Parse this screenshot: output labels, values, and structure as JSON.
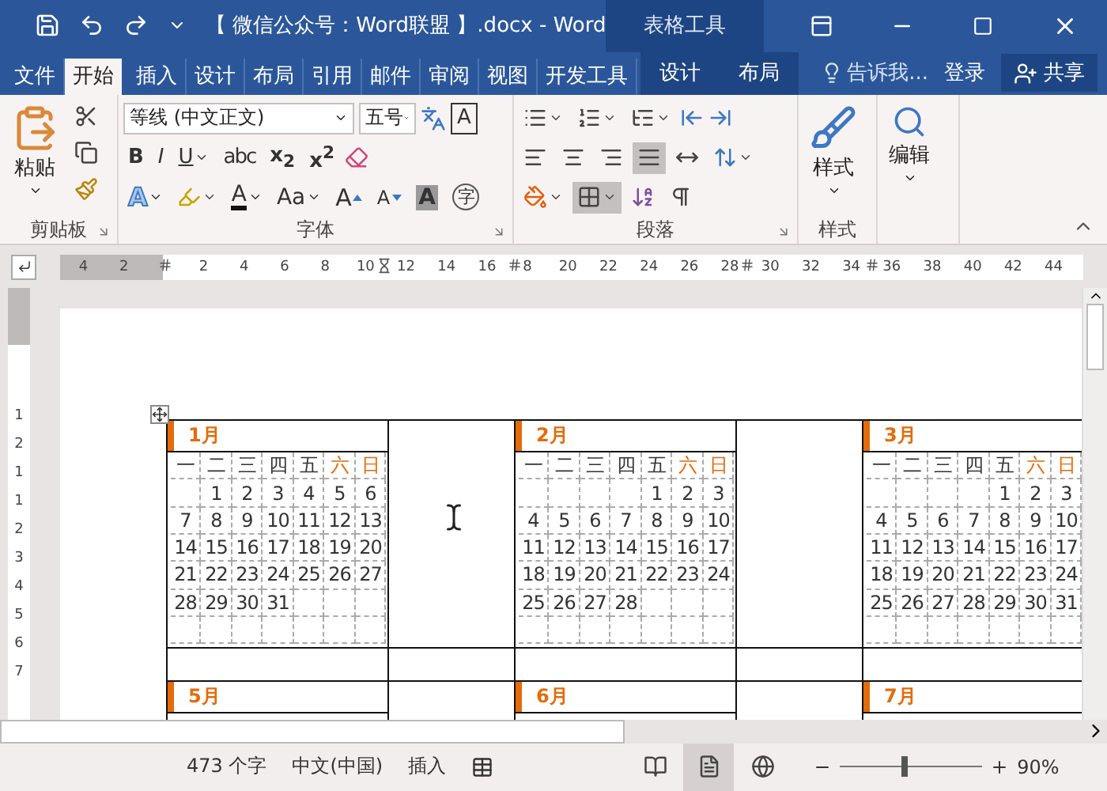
{
  "window": {
    "title": "【 微信公众号：Word联盟 】.docx - Word",
    "context_group": "表格工具"
  },
  "tabs": [
    {
      "label": "文件",
      "selected": false
    },
    {
      "label": "开始",
      "selected": true
    },
    {
      "label": "插入",
      "selected": false
    },
    {
      "label": "设计",
      "selected": false
    },
    {
      "label": "布局",
      "selected": false
    },
    {
      "label": "引用",
      "selected": false
    },
    {
      "label": "邮件",
      "selected": false
    },
    {
      "label": "审阅",
      "selected": false
    },
    {
      "label": "视图",
      "selected": false
    },
    {
      "label": "开发工具",
      "selected": false
    }
  ],
  "context_tabs": [
    {
      "label": "设计",
      "selected": false
    },
    {
      "label": "布局",
      "selected": false
    }
  ],
  "tell_me": "告诉我...",
  "sign_in": "登录",
  "share": "共享",
  "clipboard": {
    "label": "剪贴板",
    "paste": "粘贴"
  },
  "font": {
    "label": "字体",
    "font_name": "等线 (中文正文)",
    "font_size": "五号",
    "border_button": "A",
    "format_buttons": [
      {
        "label": "B",
        "kind": "bold"
      },
      {
        "label": "I",
        "kind": "italic"
      },
      {
        "label": "U",
        "kind": "underline"
      },
      {
        "label": "abc",
        "kind": "strike"
      },
      {
        "label": "x$_{2}$",
        "kind": "sub"
      },
      {
        "label": "x$^{2}$",
        "kind": "sup"
      }
    ],
    "effect_buttons": [
      {
        "label": "A",
        "kind": "effects"
      },
      {
        "kind": "highlight"
      },
      {
        "label": "A",
        "kind": "color"
      },
      {
        "label": "Aa",
        "kind": "case"
      },
      {
        "label": "A",
        "kind": "grow"
      },
      {
        "label": "A",
        "kind": "shrink"
      },
      {
        "label": "A",
        "kind": "shading"
      },
      {
        "label": "字",
        "kind": "enclose"
      }
    ]
  },
  "paragraph": {
    "label": "段落",
    "borders": {
      "selected": true
    },
    "alignment": [
      {
        "kind": "left",
        "selected": false
      },
      {
        "kind": "center",
        "selected": false
      },
      {
        "kind": "right",
        "selected": false
      },
      {
        "kind": "justify",
        "selected": true
      },
      {
        "kind": "distributed",
        "selected": false
      }
    ]
  },
  "styles": {
    "button": "样式",
    "label": "样式"
  },
  "editing": {
    "button": "编辑"
  },
  "ruler": {
    "left_labels": [
      "4",
      "2"
    ],
    "labels": [
      "2",
      "4",
      "6",
      "8",
      "10",
      "12",
      "14",
      "16",
      "8",
      "20",
      "22",
      "24",
      "26",
      "28",
      "30",
      "32",
      "34",
      "36",
      "38",
      "40",
      "42",
      "44"
    ]
  },
  "vertical_ruler": [
    "1",
    "2",
    "1",
    "1",
    "2",
    "3",
    "4",
    "5",
    "6",
    "7"
  ],
  "calendar_rows": [
    {
      "months": [
        {
          "name": "1月",
          "weekdays": [
            {
              "label": "一",
              "weekend": false
            },
            {
              "label": "二",
              "weekend": false
            },
            {
              "label": "三",
              "weekend": false
            },
            {
              "label": "四",
              "weekend": false
            },
            {
              "label": "五",
              "weekend": false
            },
            {
              "label": "六",
              "weekend": true
            },
            {
              "label": "日",
              "weekend": true
            }
          ],
          "weeks": [
            [
              "1",
              "2",
              "3",
              "4",
              "5",
              "6"
            ],
            [
              "7",
              "8",
              "9",
              "10",
              "11",
              "12",
              "13"
            ],
            [
              "14",
              "15",
              "16",
              "17",
              "18",
              "19",
              "20"
            ],
            [
              "21",
              "22",
              "23",
              "24",
              "25",
              "26",
              "27"
            ],
            [
              "28",
              "29",
              "30",
              "31"
            ]
          ]
        },
        {
          "name": "2月",
          "weekdays": [
            {
              "label": "一",
              "weekend": false
            },
            {
              "label": "二",
              "weekend": false
            },
            {
              "label": "三",
              "weekend": false
            },
            {
              "label": "四",
              "weekend": false
            },
            {
              "label": "五",
              "weekend": false
            },
            {
              "label": "六",
              "weekend": true
            },
            {
              "label": "日",
              "weekend": true
            }
          ],
          "weeks": [
            [
              "1",
              "2",
              "3"
            ],
            [
              "4",
              "5",
              "6",
              "7",
              "8",
              "9",
              "10"
            ],
            [
              "11",
              "12",
              "13",
              "14",
              "15",
              "16",
              "17"
            ],
            [
              "18",
              "19",
              "20",
              "21",
              "22",
              "23",
              "24"
            ],
            [
              "25",
              "26",
              "27",
              "28"
            ]
          ]
        },
        {
          "name": "3月",
          "weekdays": [
            {
              "label": "一",
              "weekend": false
            },
            {
              "label": "二",
              "weekend": false
            },
            {
              "label": "三",
              "weekend": false
            },
            {
              "label": "四",
              "weekend": false
            },
            {
              "label": "五",
              "weekend": false
            },
            {
              "label": "六",
              "weekend": true
            },
            {
              "label": "日",
              "weekend": true
            }
          ],
          "weeks": [
            [
              "1",
              "2",
              "3"
            ],
            [
              "4",
              "5",
              "6",
              "7",
              "8",
              "9",
              "10"
            ],
            [
              "11",
              "12",
              "13",
              "14",
              "15",
              "16",
              "17"
            ],
            [
              "18",
              "19",
              "20",
              "21",
              "22",
              "23",
              "24"
            ],
            [
              "25",
              "26",
              "27",
              "28",
              "29",
              "30",
              "31"
            ]
          ]
        }
      ]
    },
    {
      "months": [
        {
          "name": "5月"
        },
        {
          "name": "6月"
        },
        {
          "name": "7月"
        }
      ]
    }
  ],
  "status": {
    "word_count": "473 个字",
    "language": "中文(中国)",
    "mode": "插入",
    "views": [
      {
        "kind": "read",
        "selected": false
      },
      {
        "kind": "print",
        "selected": true
      },
      {
        "kind": "web",
        "selected": false
      }
    ],
    "zoom": {
      "level": 0.45,
      "reading": "90%"
    }
  }
}
